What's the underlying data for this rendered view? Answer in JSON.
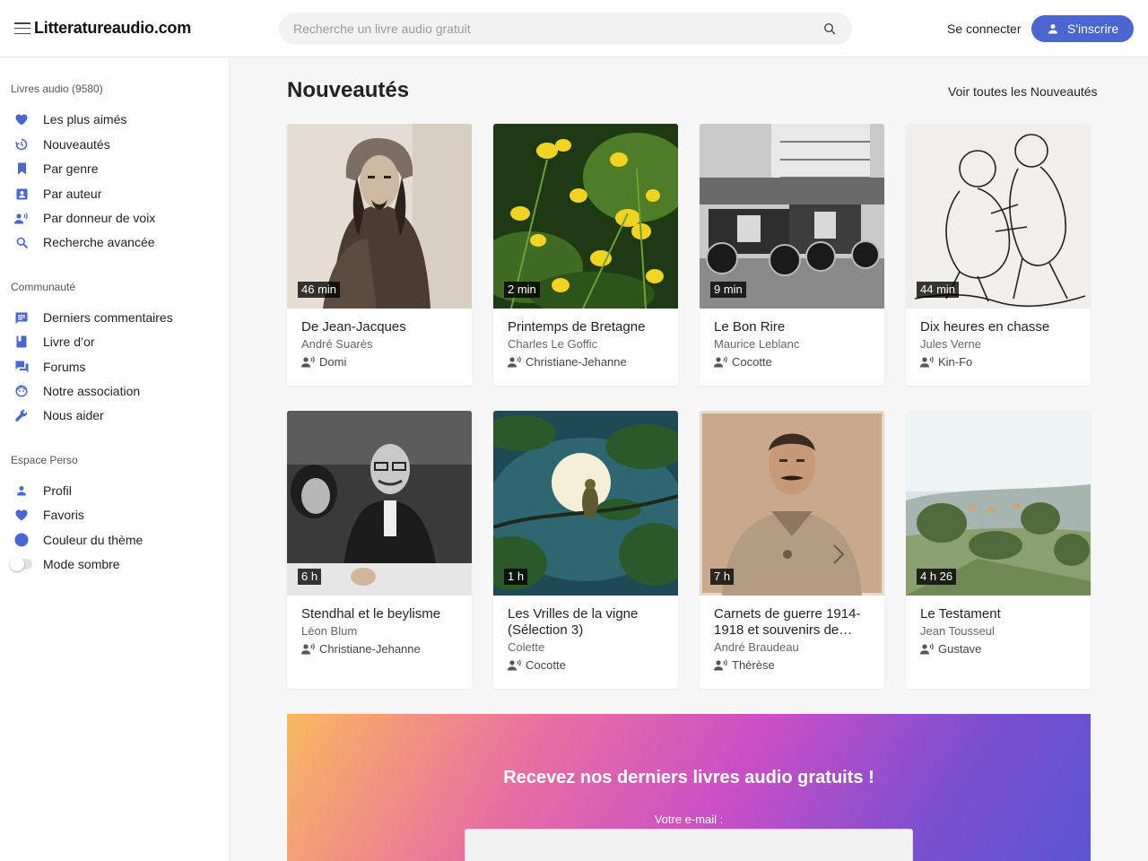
{
  "header": {
    "logo": "Litteratureaudio.com",
    "search_placeholder": "Recherche un livre audio gratuit",
    "login": "Se connecter",
    "signup": "S'inscrire"
  },
  "sidebar": {
    "section1": {
      "title": "Livres audio (9580)",
      "items": [
        {
          "label": "Les plus aimés",
          "icon": "heart-icon"
        },
        {
          "label": "Nouveautés",
          "icon": "history-icon"
        },
        {
          "label": "Par genre",
          "icon": "bookmark-icon"
        },
        {
          "label": "Par auteur",
          "icon": "contact-card-icon"
        },
        {
          "label": "Par donneur de voix",
          "icon": "voice-person-icon"
        },
        {
          "label": "Recherche avancée",
          "icon": "search-icon"
        }
      ]
    },
    "section2": {
      "title": "Communauté",
      "items": [
        {
          "label": "Derniers commentaires",
          "icon": "comment-icon"
        },
        {
          "label": "Livre d’or",
          "icon": "book-icon"
        },
        {
          "label": "Forums",
          "icon": "forum-icon"
        },
        {
          "label": "Notre association",
          "icon": "face-icon"
        },
        {
          "label": "Nous aider",
          "icon": "wrench-icon"
        }
      ]
    },
    "section3": {
      "title": "Espace Perso",
      "items": [
        {
          "label": "Profil",
          "icon": "person-icon"
        },
        {
          "label": "Favoris",
          "icon": "heart-icon"
        },
        {
          "label": "Couleur du thème",
          "icon": "color-dot-icon"
        },
        {
          "label": "Mode sombre",
          "icon": "toggle-switch-icon"
        }
      ]
    }
  },
  "main": {
    "title": "Nouveautés",
    "see_all": "Voir toutes les Nouveautés",
    "cards": [
      {
        "duration": "46 min",
        "title": "De Jean-Jacques",
        "author": "André Suarès",
        "voice": "Domi"
      },
      {
        "duration": "2 min",
        "title": "Printemps de Bretagne",
        "author": "Charles Le Goffic",
        "voice": "Christiane-Jehanne"
      },
      {
        "duration": "9 min",
        "title": "Le Bon Rire",
        "author": "Maurice Leblanc",
        "voice": "Cocotte"
      },
      {
        "duration": "44 min",
        "title": "Dix heures en chasse",
        "author": "Jules Verne",
        "voice": "Kin-Fo"
      },
      {
        "duration": "6 h",
        "title": "Stendhal et le beylisme",
        "author": "Léon Blum",
        "voice": "Christiane-Jehanne"
      },
      {
        "duration": "1 h",
        "title": "Les Vrilles de la vigne (Sélection 3)",
        "author": "Colette",
        "voice": "Cocotte"
      },
      {
        "duration": "7 h",
        "title": "Carnets de guerre 1914-1918 et souvenirs de…",
        "author": "André Braudeau",
        "voice": "Thérèse"
      },
      {
        "duration": "4 h 26",
        "title": "Le Testament",
        "author": "Jean Tousseul",
        "voice": "Gustave"
      }
    ]
  },
  "newsletter": {
    "title": "Recevez nos derniers livres audio gratuits !",
    "email_label": "Votre e-mail :"
  },
  "colors": {
    "accent": "#4966d1"
  }
}
